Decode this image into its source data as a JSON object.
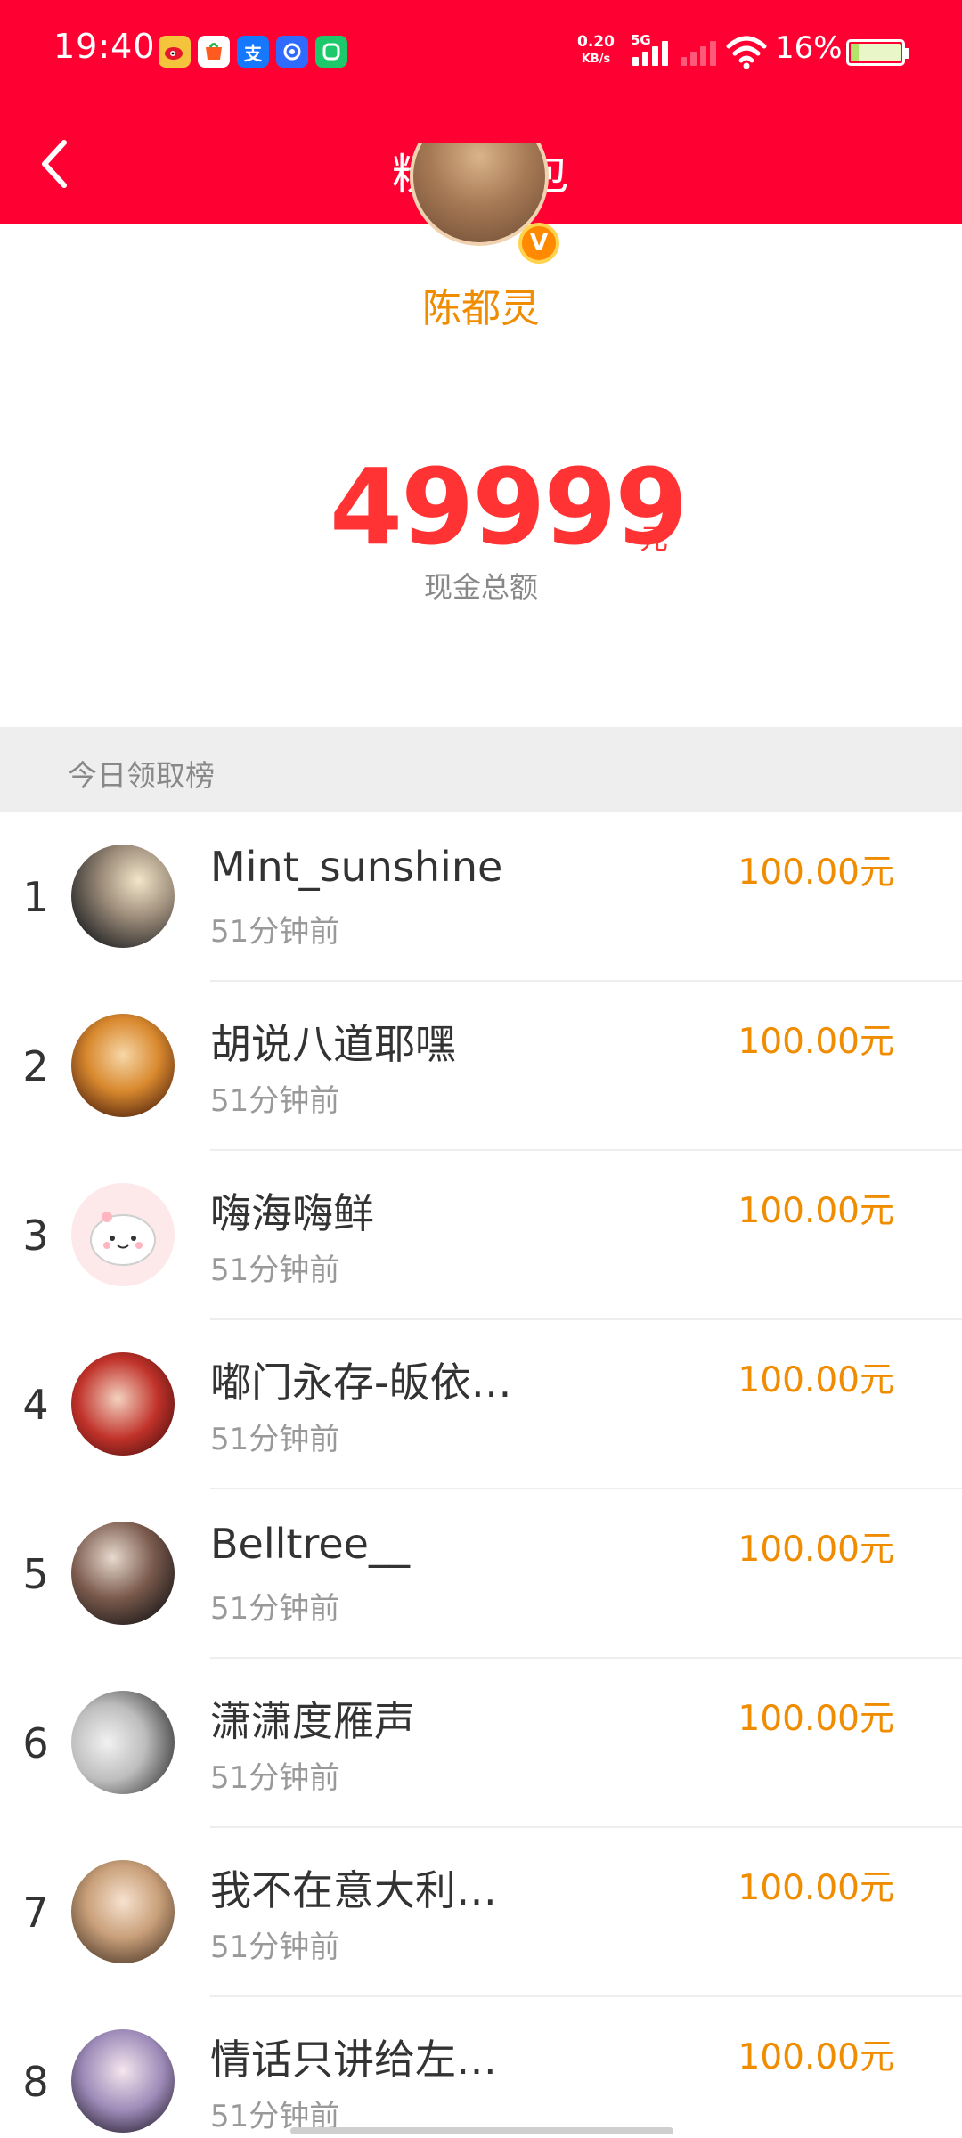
{
  "status_bar": {
    "time": "19:40",
    "net_speed_value": "0.20",
    "net_speed_unit": "KB/s",
    "network_type": "5G",
    "battery_percent": "16%",
    "battery_level": 0.16,
    "app_icons": [
      "weibo-icon",
      "store-icon",
      "alipay-icon",
      "baidu-netdisk-icon",
      "wechat-like-icon"
    ]
  },
  "header": {
    "title": "粉丝红包",
    "background_color": "#ff0033"
  },
  "profile": {
    "name": "陈都灵",
    "badge": "V"
  },
  "total": {
    "amount": "49999",
    "unit": "元",
    "caption": "现金总额",
    "color": "#ff3333"
  },
  "ranking": {
    "title": "今日领取榜",
    "entries": [
      {
        "rank": "1",
        "name": "Mint_sunshine",
        "time": "51分钟前",
        "amount": "100.00元"
      },
      {
        "rank": "2",
        "name": "胡说八道耶嘿",
        "time": "51分钟前",
        "amount": "100.00元"
      },
      {
        "rank": "3",
        "name": "嗨海嗨鲜",
        "time": "51分钟前",
        "amount": "100.00元"
      },
      {
        "rank": "4",
        "name": "嘟门永存-皈依…",
        "time": "51分钟前",
        "amount": "100.00元"
      },
      {
        "rank": "5",
        "name": "Belltree__",
        "time": "51分钟前",
        "amount": "100.00元"
      },
      {
        "rank": "6",
        "name": "潇潇度雁声",
        "time": "51分钟前",
        "amount": "100.00元"
      },
      {
        "rank": "7",
        "name": "我不在意大利…",
        "time": "51分钟前",
        "amount": "100.00元"
      },
      {
        "rank": "8",
        "name": "情话只讲给左…",
        "time": "51分钟前",
        "amount": "100.00元"
      }
    ]
  }
}
